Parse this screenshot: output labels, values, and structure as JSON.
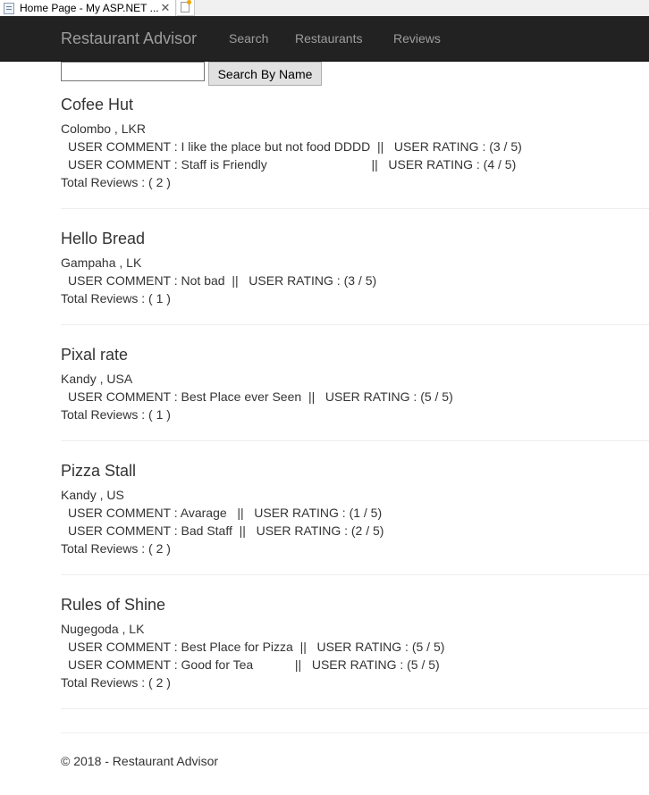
{
  "browser": {
    "tab_title": "Home Page - My ASP.NET ...",
    "close_glyph": "✕"
  },
  "navbar": {
    "brand": "Restaurant Advisor",
    "links": [
      "Search",
      "Restaurants",
      "Reviews"
    ]
  },
  "search": {
    "value": "",
    "button_label": "Search By Name"
  },
  "restaurants": [
    {
      "name": "Cofee Hut",
      "location": "Colombo , LKR",
      "reviews": [
        "USER COMMENT : I like the place but not food DDDD  ||   USER RATING : (3 / 5)",
        "USER COMMENT : Staff is Friendly                              ||   USER RATING : (4 / 5)"
      ],
      "total": "Total Reviews : ( 2 )"
    },
    {
      "name": "Hello Bread",
      "location": "Gampaha , LK",
      "reviews": [
        "USER COMMENT : Not bad  ||   USER RATING : (3 / 5)"
      ],
      "total": "Total Reviews : ( 1 )"
    },
    {
      "name": "Pixal rate",
      "location": "Kandy , USA",
      "reviews": [
        "USER COMMENT : Best Place ever Seen  ||   USER RATING : (5 / 5)"
      ],
      "total": "Total Reviews : ( 1 )"
    },
    {
      "name": "Pizza Stall",
      "location": "Kandy , US",
      "reviews": [
        "USER COMMENT : Avarage   ||   USER RATING : (1 / 5)",
        "USER COMMENT : Bad Staff  ||   USER RATING : (2 / 5)"
      ],
      "total": "Total Reviews : ( 2 )"
    },
    {
      "name": "Rules of Shine",
      "location": "Nugegoda , LK",
      "reviews": [
        "USER COMMENT : Best Place for Pizza  ||   USER RATING : (5 / 5)",
        "USER COMMENT : Good for Tea            ||   USER RATING : (5 / 5)"
      ],
      "total": "Total Reviews : ( 2 )"
    }
  ],
  "footer": "© 2018 - Restaurant Advisor"
}
